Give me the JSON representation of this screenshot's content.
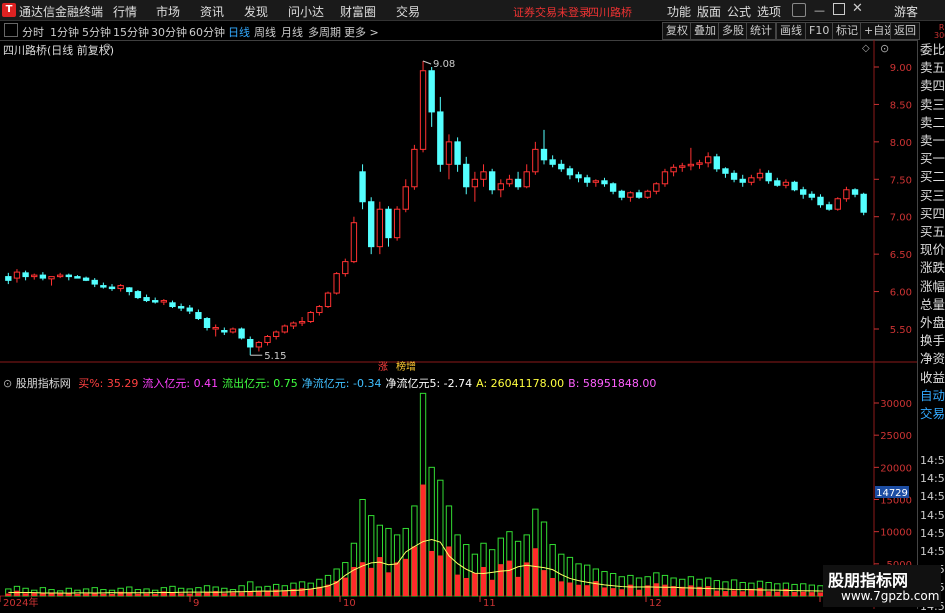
{
  "menubar": {
    "logo": "T",
    "app_name": "通达信金融终端",
    "items": [
      "行情",
      "市场",
      "资讯",
      "发现",
      "问小达",
      "财富圈",
      "交易"
    ],
    "warning": "证券交易未登录",
    "stock_name": "四川路桥",
    "right_items": [
      "功能",
      "版面",
      "公式",
      "选项"
    ],
    "guest": "游客"
  },
  "toolbar": {
    "periods": [
      "分时",
      "1分钟",
      "5分钟",
      "15分钟",
      "30分钟",
      "60分钟",
      "日线",
      "周线",
      "月线",
      "多周期",
      "更多 >"
    ],
    "active_period": "日线",
    "buttons": [
      "复权",
      "叠加",
      "多股",
      "统计",
      "画线",
      "F10",
      "标记",
      "+自选",
      "返回"
    ]
  },
  "main_chart": {
    "title": "四川路桥(日线 前复权)",
    "high_marker": "9.08",
    "low_marker": "5.15",
    "tags": [
      "涨",
      "榜增"
    ]
  },
  "indicator": {
    "name": "股朋指标网",
    "fields": [
      {
        "label": "买%:",
        "value": "35.29",
        "color": "#ff4040"
      },
      {
        "label": "流入亿元:",
        "value": "0.41",
        "color": "#ff40ff"
      },
      {
        "label": "流出亿元:",
        "value": "0.75",
        "color": "#40ff40"
      },
      {
        "label": "净流亿元:",
        "value": "-0.34",
        "color": "#40c0ff"
      },
      {
        "label": "净流亿元5:",
        "value": "-2.74",
        "color": "#ffffff"
      },
      {
        "label": "A:",
        "value": "26041178.00",
        "color": "#ffff40"
      },
      {
        "label": "B:",
        "value": "58951848.00",
        "color": "#ff60ff"
      }
    ]
  },
  "right_panel": {
    "corner": [
      "R",
      "300"
    ],
    "rows": [
      "委比",
      "卖五",
      "卖四",
      "卖三",
      "卖二",
      "卖一",
      "买一",
      "买二",
      "买三",
      "买四",
      "买五",
      "现价",
      "涨跌",
      "涨幅",
      "总量",
      "外盘",
      "换手",
      "净资",
      "收益",
      "自动",
      "交易"
    ],
    "times": [
      "14:56",
      "14:56",
      "14:56",
      "14:56",
      "14:56",
      "14:56",
      "14:56",
      "14:56",
      "14:56"
    ],
    "price_box": "14729"
  },
  "chart_data": [
    {
      "type": "candlestick",
      "y_ticks": [
        "9.00",
        "8.50",
        "8.00",
        "7.50",
        "7.00",
        "6.50",
        "6.00",
        "5.50"
      ],
      "ylim": [
        5.15,
        9.08
      ],
      "x_labels": [
        "2024年",
        "9",
        "10",
        "11",
        "12",
        "1"
      ],
      "ohlc": [
        [
          6.2,
          6.25,
          6.1,
          6.15
        ],
        [
          6.18,
          6.3,
          6.12,
          6.26
        ],
        [
          6.25,
          6.28,
          6.15,
          6.2
        ],
        [
          6.2,
          6.24,
          6.16,
          6.22
        ],
        [
          6.22,
          6.26,
          6.15,
          6.18
        ],
        [
          6.17,
          6.2,
          6.08,
          6.2
        ],
        [
          6.2,
          6.25,
          6.18,
          6.22
        ],
        [
          6.22,
          6.24,
          6.15,
          6.2
        ],
        [
          6.2,
          6.22,
          6.18,
          6.18
        ],
        [
          6.18,
          6.2,
          6.14,
          6.15
        ],
        [
          6.15,
          6.18,
          6.06,
          6.1
        ],
        [
          6.08,
          6.12,
          6.04,
          6.06
        ],
        [
          6.06,
          6.1,
          6.01,
          6.04
        ],
        [
          6.04,
          6.1,
          6.0,
          6.08
        ],
        [
          6.05,
          6.06,
          5.95,
          6.0
        ],
        [
          6.0,
          6.02,
          5.9,
          5.92
        ],
        [
          5.92,
          5.96,
          5.86,
          5.88
        ],
        [
          5.88,
          5.92,
          5.84,
          5.86
        ],
        [
          5.86,
          5.9,
          5.82,
          5.88
        ],
        [
          5.85,
          5.88,
          5.78,
          5.8
        ],
        [
          5.8,
          5.84,
          5.74,
          5.78
        ],
        [
          5.78,
          5.82,
          5.7,
          5.74
        ],
        [
          5.72,
          5.76,
          5.62,
          5.64
        ],
        [
          5.64,
          5.66,
          5.48,
          5.52
        ],
        [
          5.5,
          5.56,
          5.4,
          5.52
        ],
        [
          5.48,
          5.52,
          5.42,
          5.46
        ],
        [
          5.46,
          5.52,
          5.44,
          5.5
        ],
        [
          5.5,
          5.52,
          5.36,
          5.38
        ],
        [
          5.36,
          5.4,
          5.15,
          5.26
        ],
        [
          5.26,
          5.34,
          5.2,
          5.32
        ],
        [
          5.32,
          5.42,
          5.28,
          5.4
        ],
        [
          5.4,
          5.48,
          5.36,
          5.46
        ],
        [
          5.46,
          5.56,
          5.44,
          5.54
        ],
        [
          5.54,
          5.6,
          5.5,
          5.58
        ],
        [
          5.58,
          5.66,
          5.54,
          5.6
        ],
        [
          5.6,
          5.74,
          5.58,
          5.72
        ],
        [
          5.72,
          5.82,
          5.68,
          5.8
        ],
        [
          5.8,
          6.0,
          5.78,
          5.98
        ],
        [
          5.98,
          6.26,
          5.96,
          6.24
        ],
        [
          6.24,
          6.44,
          6.2,
          6.4
        ],
        [
          6.4,
          7.0,
          6.38,
          6.92
        ],
        [
          7.6,
          7.7,
          7.1,
          7.2
        ],
        [
          7.2,
          7.26,
          6.5,
          6.6
        ],
        [
          6.6,
          7.2,
          6.5,
          7.1
        ],
        [
          7.1,
          7.14,
          6.6,
          6.72
        ],
        [
          6.72,
          7.14,
          6.68,
          7.1
        ],
        [
          7.1,
          7.5,
          7.06,
          7.4
        ],
        [
          7.4,
          7.96,
          7.36,
          7.9
        ],
        [
          7.9,
          9.08,
          7.86,
          8.95
        ],
        [
          8.95,
          9.0,
          8.2,
          8.4
        ],
        [
          8.4,
          8.6,
          7.6,
          7.7
        ],
        [
          7.7,
          8.1,
          7.5,
          8.0
        ],
        [
          8.0,
          8.06,
          7.6,
          7.7
        ],
        [
          7.7,
          7.8,
          7.3,
          7.4
        ],
        [
          7.4,
          7.6,
          7.2,
          7.5
        ],
        [
          7.5,
          7.7,
          7.4,
          7.6
        ],
        [
          7.6,
          7.64,
          7.3,
          7.36
        ],
        [
          7.36,
          7.5,
          7.26,
          7.44
        ],
        [
          7.44,
          7.56,
          7.4,
          7.5
        ],
        [
          7.5,
          7.6,
          7.36,
          7.4
        ],
        [
          7.4,
          7.7,
          7.38,
          7.6
        ],
        [
          7.6,
          8.0,
          7.56,
          7.9
        ],
        [
          7.9,
          8.16,
          7.7,
          7.76
        ],
        [
          7.76,
          7.82,
          7.66,
          7.7
        ],
        [
          7.7,
          7.76,
          7.6,
          7.64
        ],
        [
          7.64,
          7.68,
          7.5,
          7.56
        ],
        [
          7.56,
          7.6,
          7.46,
          7.52
        ],
        [
          7.52,
          7.56,
          7.4,
          7.46
        ],
        [
          7.46,
          7.5,
          7.4,
          7.48
        ],
        [
          7.48,
          7.52,
          7.4,
          7.44
        ],
        [
          7.44,
          7.46,
          7.3,
          7.34
        ],
        [
          7.34,
          7.36,
          7.22,
          7.26
        ],
        [
          7.26,
          7.34,
          7.2,
          7.32
        ],
        [
          7.32,
          7.36,
          7.24,
          7.26
        ],
        [
          7.26,
          7.36,
          7.24,
          7.34
        ],
        [
          7.34,
          7.46,
          7.3,
          7.44
        ],
        [
          7.44,
          7.64,
          7.4,
          7.6
        ],
        [
          7.6,
          7.7,
          7.54,
          7.66
        ],
        [
          7.66,
          7.72,
          7.6,
          7.68
        ],
        [
          7.68,
          7.92,
          7.62,
          7.7
        ],
        [
          7.7,
          7.76,
          7.64,
          7.72
        ],
        [
          7.72,
          7.86,
          7.66,
          7.8
        ],
        [
          7.8,
          7.84,
          7.6,
          7.64
        ],
        [
          7.64,
          7.66,
          7.52,
          7.58
        ],
        [
          7.58,
          7.62,
          7.46,
          7.5
        ],
        [
          7.5,
          7.56,
          7.4,
          7.46
        ],
        [
          7.46,
          7.56,
          7.42,
          7.52
        ],
        [
          7.52,
          7.64,
          7.48,
          7.58
        ],
        [
          7.58,
          7.62,
          7.44,
          7.48
        ],
        [
          7.48,
          7.52,
          7.4,
          7.42
        ],
        [
          7.42,
          7.5,
          7.38,
          7.46
        ],
        [
          7.46,
          7.48,
          7.34,
          7.36
        ],
        [
          7.36,
          7.4,
          7.24,
          7.3
        ],
        [
          7.3,
          7.34,
          7.22,
          7.26
        ],
        [
          7.26,
          7.3,
          7.12,
          7.16
        ],
        [
          7.16,
          7.2,
          7.08,
          7.1
        ],
        [
          7.1,
          7.26,
          7.08,
          7.24
        ],
        [
          7.24,
          7.4,
          7.2,
          7.36
        ],
        [
          7.36,
          7.38,
          7.26,
          7.3
        ],
        [
          7.3,
          7.32,
          7.02,
          7.06
        ]
      ]
    },
    {
      "type": "bar",
      "y_ticks": [
        "30000",
        "25000",
        "20000",
        "15000",
        "10000",
        "5000"
      ],
      "ylim": [
        0,
        32000
      ],
      "volumes": [
        1100,
        1500,
        1200,
        900,
        1300,
        1000,
        800,
        1200,
        900,
        1100,
        1300,
        1000,
        900,
        1200,
        1400,
        1000,
        1100,
        900,
        1300,
        1500,
        1200,
        1100,
        1300,
        1600,
        1400,
        1200,
        1000,
        1600,
        2200,
        1400,
        1500,
        1800,
        1600,
        2000,
        2200,
        2000,
        2600,
        3200,
        4200,
        5200,
        8200,
        15000,
        12500,
        11000,
        10500,
        9500,
        10500,
        14000,
        31500,
        20000,
        18000,
        14000,
        9500,
        8000,
        6500,
        8200,
        7200,
        9000,
        10000,
        8500,
        9500,
        13500,
        11500,
        8000,
        6500,
        6000,
        5000,
        4800,
        4200,
        3800,
        3500,
        3000,
        3200,
        2800,
        3000,
        3600,
        3200,
        2800,
        2600,
        3000,
        2600,
        2800,
        2400,
        2200,
        2500,
        2100,
        2000,
        2300,
        2100,
        1900,
        2000,
        1800,
        1900,
        1700,
        1600,
        1800,
        1700,
        1600,
        1500,
        1900
      ],
      "up": [
        0,
        1,
        0,
        1,
        0,
        1,
        1,
        0,
        0,
        0,
        0,
        0,
        0,
        1,
        0,
        0,
        0,
        0,
        1,
        0,
        0,
        0,
        0,
        0,
        1,
        0,
        1,
        0,
        0,
        1,
        1,
        1,
        1,
        1,
        1,
        1,
        1,
        1,
        1,
        1,
        1,
        0,
        0,
        1,
        0,
        1,
        1,
        1,
        1,
        0,
        0,
        1,
        0,
        0,
        1,
        1,
        0,
        1,
        1,
        0,
        1,
        1,
        0,
        0,
        0,
        0,
        0,
        0,
        1,
        0,
        0,
        0,
        1,
        0,
        1,
        1,
        1,
        1,
        1,
        1,
        1,
        1,
        0,
        0,
        0,
        0,
        1,
        1,
        0,
        0,
        1,
        0,
        0,
        0,
        0,
        0,
        1,
        1,
        0,
        0
      ]
    }
  ]
}
